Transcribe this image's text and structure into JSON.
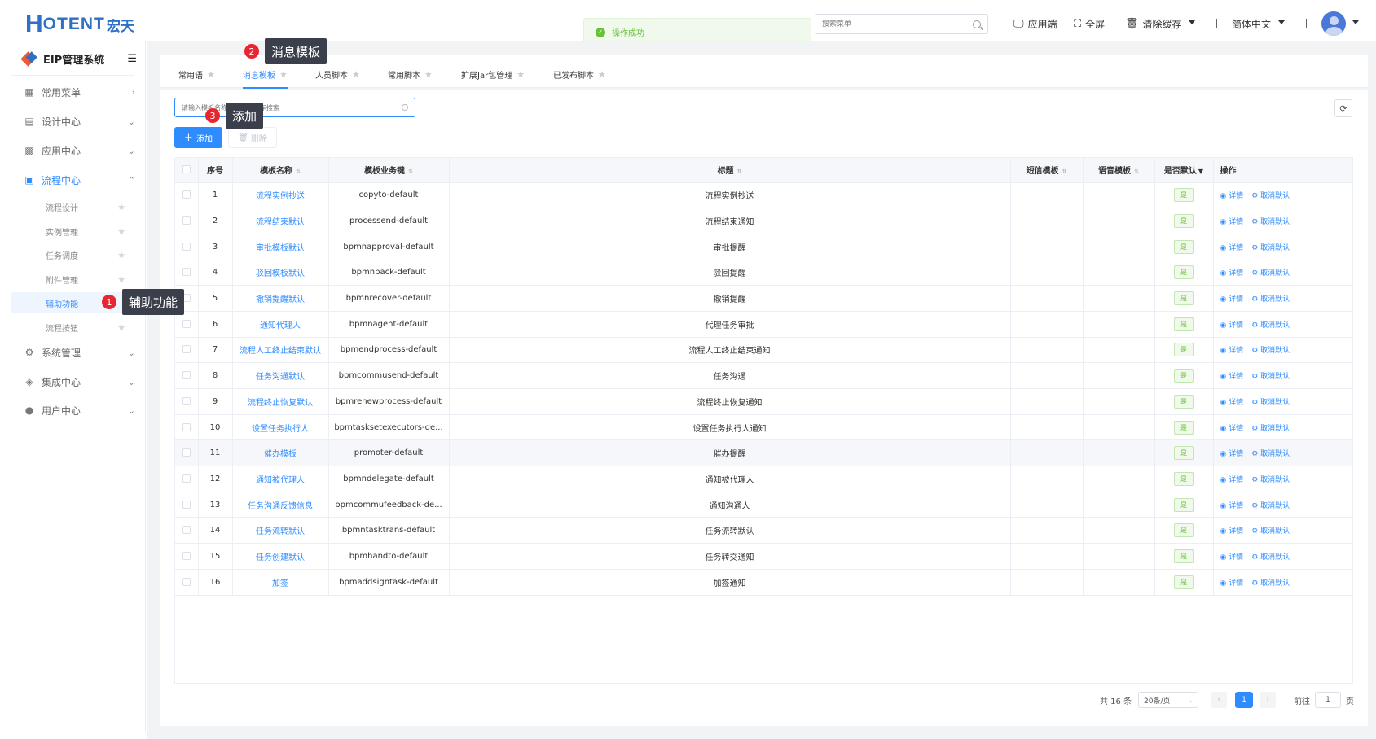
{
  "brand": {
    "logo_h": "H",
    "logo_oten": "OTENT",
    "logo_cn": "宏天"
  },
  "toast": {
    "text": "操作成功"
  },
  "header": {
    "search_placeholder": "搜索菜单",
    "app_label": "应用端",
    "fullscreen_label": "全屏",
    "clear_cache_label": "清除缓存",
    "lang_label": "简体中文"
  },
  "sidebar": {
    "title": "EIP管理系统",
    "items": [
      {
        "label": "常用菜单",
        "icon": "▦",
        "arrow": "›"
      },
      {
        "label": "设计中心",
        "icon": "▤",
        "arrow": "⌄"
      },
      {
        "label": "应用中心",
        "icon": "▩",
        "arrow": "⌄"
      },
      {
        "label": "流程中心",
        "icon": "▣",
        "arrow": "⌃"
      },
      {
        "label": "系统管理",
        "icon": "⚙",
        "arrow": "⌄"
      },
      {
        "label": "集成中心",
        "icon": "◈",
        "arrow": "⌄"
      },
      {
        "label": "用户中心",
        "icon": "●",
        "arrow": "⌄"
      }
    ],
    "sub_items": [
      {
        "label": "流程设计"
      },
      {
        "label": "实例管理"
      },
      {
        "label": "任务调度"
      },
      {
        "label": "附件管理"
      },
      {
        "label": "辅助功能"
      },
      {
        "label": "流程按钮"
      }
    ]
  },
  "tabs": [
    {
      "label": "常用语"
    },
    {
      "label": "消息模板"
    },
    {
      "label": "人员脚本"
    },
    {
      "label": "常用脚本"
    },
    {
      "label": "扩展Jar包管理"
    },
    {
      "label": "已发布脚本"
    }
  ],
  "filter": {
    "placeholder": "请输入模板名称，关键字回车搜索"
  },
  "toolbar": {
    "add_label": "添加",
    "delete_label": "删除"
  },
  "table": {
    "headers": {
      "seq": "序号",
      "name": "模板名称",
      "key": "模板业务键",
      "subject": "标题",
      "sms": "短信模板",
      "voice": "语音模板",
      "default": "是否默认",
      "ops": "操作"
    },
    "rows": [
      {
        "seq": "1",
        "name": "流程实例抄送",
        "key": "copyto-default",
        "subject": "流程实例抄送",
        "default": "是"
      },
      {
        "seq": "2",
        "name": "流程结束默认",
        "key": "processend-default",
        "subject": "流程结束通知",
        "default": "是"
      },
      {
        "seq": "3",
        "name": "审批模板默认",
        "key": "bpmnapproval-default",
        "subject": "审批提醒",
        "default": "是"
      },
      {
        "seq": "4",
        "name": "驳回模板默认",
        "key": "bpmnback-default",
        "subject": "驳回提醒",
        "default": "是"
      },
      {
        "seq": "5",
        "name": "撤销提醒默认",
        "key": "bpmnrecover-default",
        "subject": "撤销提醒",
        "default": "是"
      },
      {
        "seq": "6",
        "name": "通知代理人",
        "key": "bpmnagent-default",
        "subject": "代理任务审批",
        "default": "是"
      },
      {
        "seq": "7",
        "name": "流程人工终止结束默认",
        "key": "bpmendprocess-default",
        "subject": "流程人工终止结束通知",
        "default": "是"
      },
      {
        "seq": "8",
        "name": "任务沟通默认",
        "key": "bpmcommusend-default",
        "subject": "任务沟通",
        "default": "是"
      },
      {
        "seq": "9",
        "name": "流程终止恢复默认",
        "key": "bpmrenewprocess-default",
        "subject": "流程终止恢复通知",
        "default": "是"
      },
      {
        "seq": "10",
        "name": "设置任务执行人",
        "key": "bpmtasksetexecutors-de...",
        "subject": "设置任务执行人通知",
        "default": "是"
      },
      {
        "seq": "11",
        "name": "催办模板",
        "key": "promoter-default",
        "subject": "催办提醒",
        "default": "是"
      },
      {
        "seq": "12",
        "name": "通知被代理人",
        "key": "bpmndelegate-default",
        "subject": "通知被代理人",
        "default": "是"
      },
      {
        "seq": "13",
        "name": "任务沟通反馈信息",
        "key": "bpmcommufeedback-de...",
        "subject": "通知沟通人",
        "default": "是"
      },
      {
        "seq": "14",
        "name": "任务流转默认",
        "key": "bpmntasktrans-default",
        "subject": "任务流转默认",
        "default": "是"
      },
      {
        "seq": "15",
        "name": "任务创建默认",
        "key": "bpmhandto-default",
        "subject": "任务转交通知",
        "default": "是"
      },
      {
        "seq": "16",
        "name": "加签",
        "key": "bpmaddsigntask-default",
        "subject": "加签通知",
        "default": "是"
      }
    ],
    "op_detail": "详情",
    "op_cancel": "取消默认"
  },
  "pagination": {
    "total": "共 16 条",
    "page_size": "20条/页",
    "current": "1",
    "goto_prefix": "前往",
    "goto_value": "1",
    "goto_suffix": "页"
  },
  "callouts": [
    {
      "num": "1",
      "label": "辅助功能"
    },
    {
      "num": "2",
      "label": "消息模板"
    },
    {
      "num": "3",
      "label": "添加"
    }
  ],
  "colors": {
    "accent": "#2f8cff",
    "success": "#67c23a",
    "callout_red": "#e8262f",
    "callout_bg": "#3a3f4b"
  }
}
